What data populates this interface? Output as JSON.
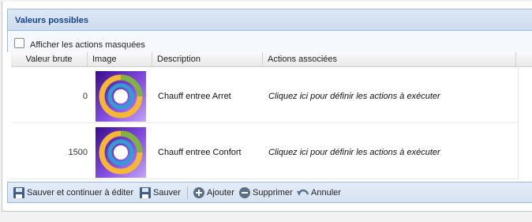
{
  "panel": {
    "title": "Valeurs possibles"
  },
  "options": {
    "show_hidden_label": "Afficher les actions masquées",
    "show_hidden_checked": false
  },
  "columns": [
    "Valeur brute",
    "Image",
    "Description",
    "Actions associées"
  ],
  "rows": [
    {
      "value": "0",
      "description": "Chauff entree Arret",
      "actions": "Cliquez ici pour définir les actions à exécuter",
      "image_icon": "heating-ring-icon"
    },
    {
      "value": "1500",
      "description": "Chauff entree Confort",
      "actions": "Cliquez ici pour définir les actions à exécuter",
      "image_icon": "heating-ring-icon"
    }
  ],
  "toolbar": {
    "save_continue": "Sauver et continuer à éditer",
    "save": "Sauver",
    "add": "Ajouter",
    "delete": "Supprimer",
    "cancel": "Annuler"
  },
  "colors": {
    "header_text": "#15428b",
    "border_blue": "#99bbe8"
  }
}
